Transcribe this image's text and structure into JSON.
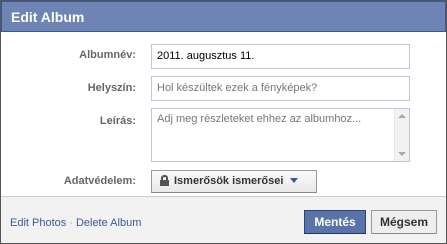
{
  "dialog": {
    "title": "Edit Album"
  },
  "form": {
    "album_name": {
      "label": "Albumnév:",
      "value": "2011. augusztus 11."
    },
    "location": {
      "label": "Helyszín:",
      "placeholder": "Hol készültek ezek a fényképek?"
    },
    "description": {
      "label": "Leírás:",
      "placeholder": "Adj meg részleteket ehhez az albumhoz..."
    },
    "privacy": {
      "label": "Adatvédelem:",
      "value": "Ismerősök ismerősei",
      "icon": "lock-icon"
    }
  },
  "footer": {
    "edit_photos": "Edit Photos",
    "separator": "·",
    "delete_album": "Delete Album",
    "save_label": "Mentés",
    "cancel_label": "Mégsem"
  },
  "colors": {
    "titlebar": "#6d84b4",
    "link": "#3b5998",
    "primary_button": "#5b74a8"
  }
}
